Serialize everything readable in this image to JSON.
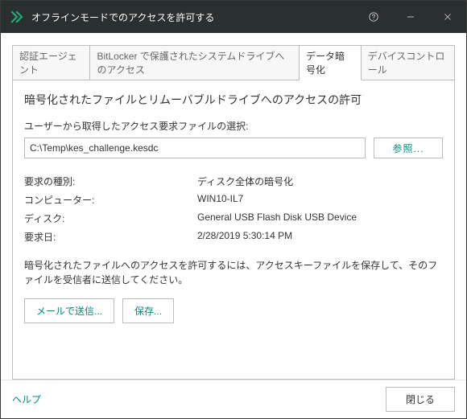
{
  "titlebar": {
    "title": "オフラインモードでのアクセスを許可する"
  },
  "tabs": [
    {
      "label": "認証エージェント"
    },
    {
      "label": "BitLocker で保護されたシステムドライブへのアクセス"
    },
    {
      "label": "データ暗号化"
    },
    {
      "label": "デバイスコントロール"
    }
  ],
  "panel": {
    "heading": "暗号化されたファイルとリムーバブルドライブへのアクセスの許可",
    "request_file_label": "ユーザーから取得したアクセス要求ファイルの選択:",
    "request_file_path": "C:\\Temp\\kes_challenge.kesdc",
    "browse_label": "参照...",
    "kv": [
      {
        "k": "要求の種別:",
        "v": "ディスク全体の暗号化"
      },
      {
        "k": "コンピューター:",
        "v": "WIN10-IL7"
      },
      {
        "k": "ディスク:",
        "v": "General USB Flash Disk USB Device"
      },
      {
        "k": "要求日:",
        "v": "2/28/2019 5:30:14 PM"
      }
    ],
    "instruction": "暗号化されたファイルへのアクセスを許可するには、アクセスキーファイルを保存して、そのファイルを受信者に送信してください。",
    "send_email_label": "メールで送信...",
    "save_label": "保存..."
  },
  "footer": {
    "help_label": "ヘルプ",
    "close_label": "閉じる"
  }
}
